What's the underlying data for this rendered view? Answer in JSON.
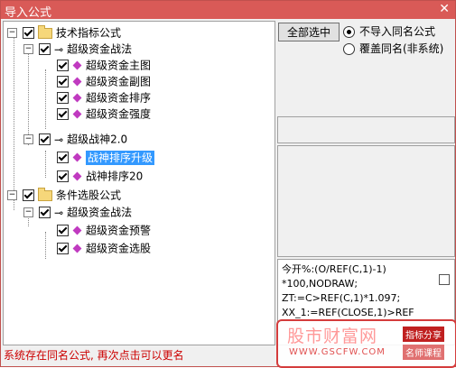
{
  "window": {
    "title": "导入公式",
    "close_glyph": "✕"
  },
  "tree": {
    "nodes": [
      {
        "id": "n0",
        "label": "技术指标公式",
        "type": "folder"
      },
      {
        "id": "n1",
        "label": "超级资金战法",
        "type": "group"
      },
      {
        "id": "n2",
        "label": "超级资金主图",
        "type": "item"
      },
      {
        "id": "n3",
        "label": "超级资金副图",
        "type": "item"
      },
      {
        "id": "n4",
        "label": "超级资金排序",
        "type": "item"
      },
      {
        "id": "n5",
        "label": "超级资金强度",
        "type": "item"
      },
      {
        "id": "n6",
        "label": "超级战神2.0",
        "type": "group"
      },
      {
        "id": "n7",
        "label": "战神排序升级",
        "type": "item",
        "selected": true
      },
      {
        "id": "n8",
        "label": "战神排序20",
        "type": "item"
      },
      {
        "id": "n9",
        "label": "条件选股公式",
        "type": "folder"
      },
      {
        "id": "n10",
        "label": "超级资金战法",
        "type": "group"
      },
      {
        "id": "n11",
        "label": "超级资金预警",
        "type": "item"
      },
      {
        "id": "n12",
        "label": "超级资金选股",
        "type": "item"
      }
    ]
  },
  "toolbar": {
    "select_all_label": "全部选中"
  },
  "options": {
    "no_import_label": "不导入同名公式",
    "overwrite_label": "覆盖同名(非系统)",
    "selected": "no_import"
  },
  "code": {
    "text": "今开%:(O/REF(C,1)-1)\n*100,NODRAW;\nZT:=C>REF(C,1)*1.097;\nXX_1:=REF(CLOSE,1)>REF"
  },
  "status": {
    "message": "系统存在同名公式, 再次点击可以更名"
  },
  "watermark": {
    "brand": "股市财富网",
    "url": "WWW.GSCFW.COM",
    "tag1": "指标分享",
    "tag2": "名师课程",
    "color": "#d43c3c"
  },
  "colors": {
    "title_bar": "#d95a57",
    "selection": "#3399ff",
    "status_text": "#cc0000"
  }
}
